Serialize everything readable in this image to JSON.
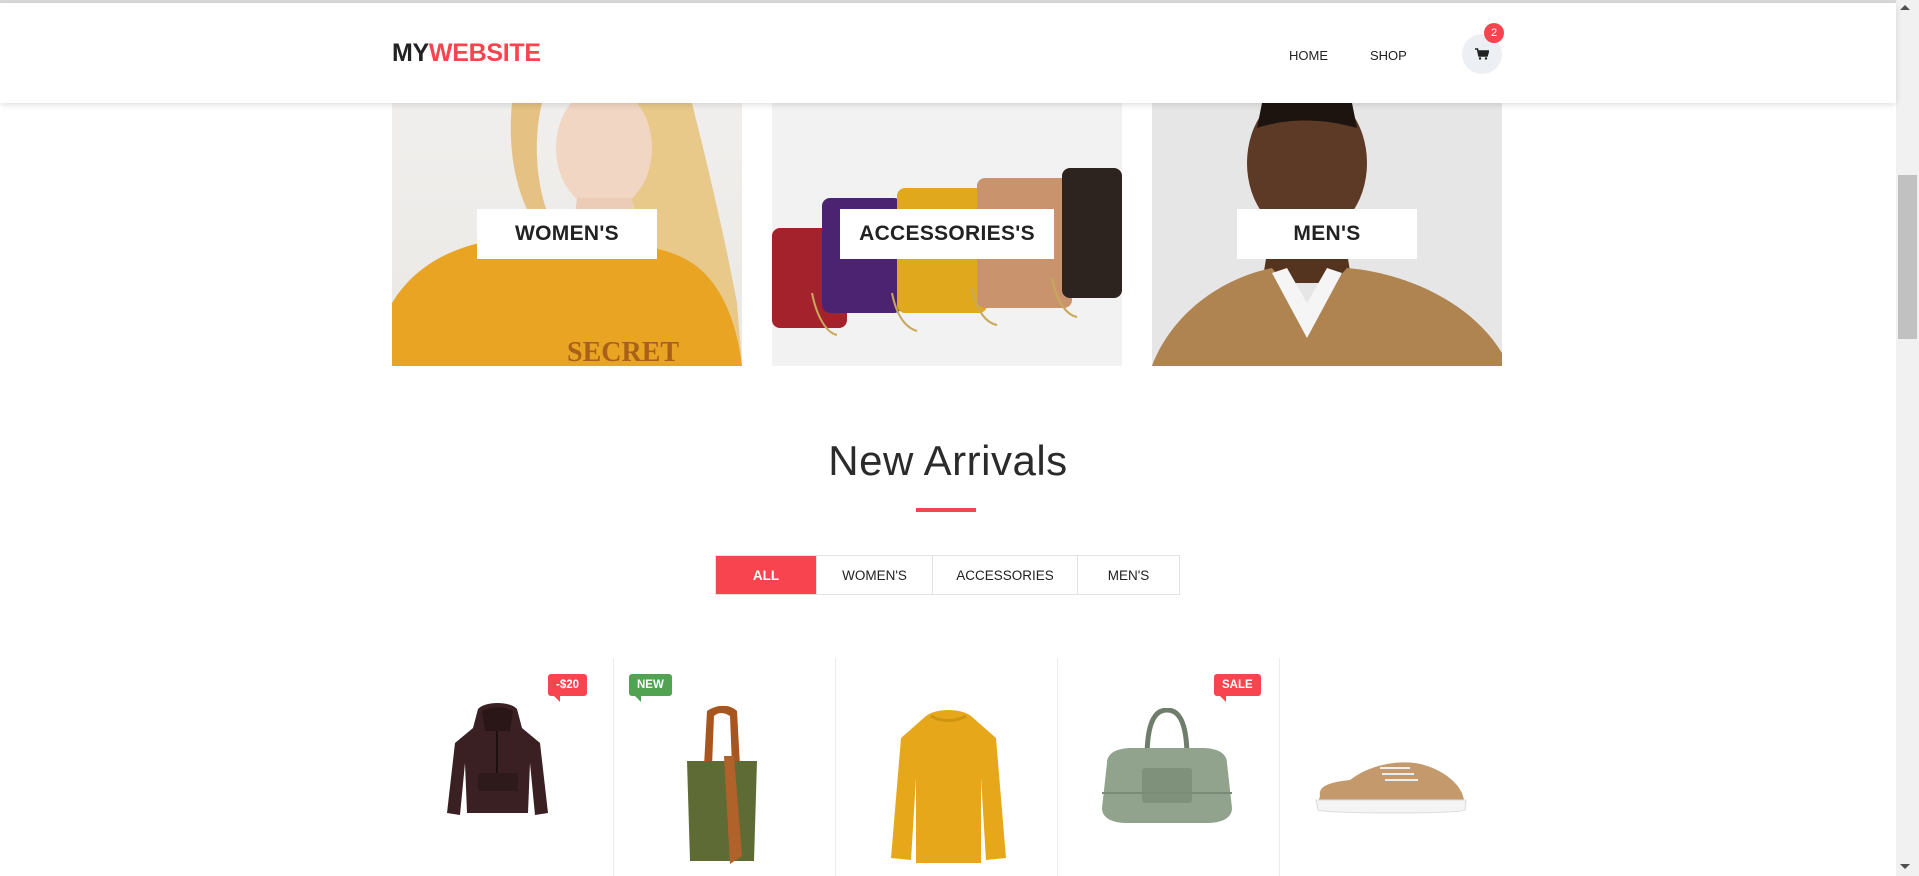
{
  "header": {
    "logo_part1": "MY",
    "logo_part2": "WEBSITE",
    "nav": {
      "home": "HOME",
      "shop": "SHOP"
    },
    "cart_count": "2"
  },
  "categories": [
    {
      "label": "WOMEN'S"
    },
    {
      "label": "ACCESSORIES'S"
    },
    {
      "label": "MEN'S"
    }
  ],
  "section": {
    "title": "New Arrivals"
  },
  "filters": {
    "all": "ALL",
    "women": "WOMEN'S",
    "accessories": "ACCESSORIES",
    "men": "MEN'S"
  },
  "products": [
    {
      "item": "hoodie",
      "tag": "-$20"
    },
    {
      "item": "tote-bag",
      "tag": "NEW"
    },
    {
      "item": "sweater",
      "tag": ""
    },
    {
      "item": "duffel-bag",
      "tag": "SALE"
    },
    {
      "item": "sneaker",
      "tag": ""
    }
  ],
  "colors": {
    "accent": "#f7444e",
    "new_tag": "#51a351",
    "text": "#222222"
  }
}
